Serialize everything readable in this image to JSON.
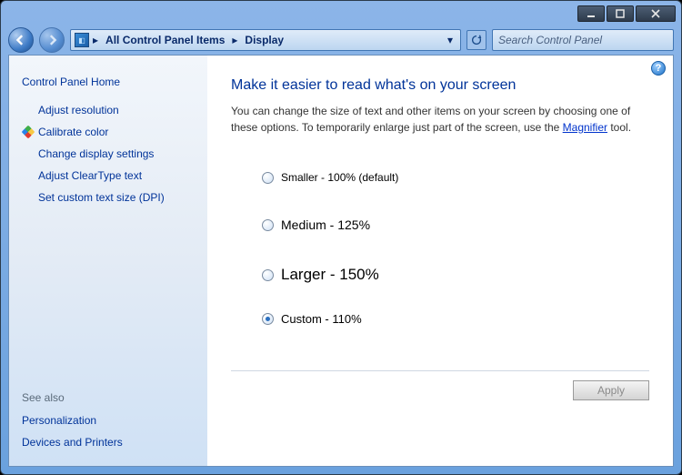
{
  "titlebar": {
    "minimize_tooltip": "Minimize",
    "maximize_tooltip": "Maximize",
    "close_tooltip": "Close"
  },
  "nav": {
    "crumb1": "All Control Panel Items",
    "crumb2": "Display",
    "search_placeholder": "Search Control Panel"
  },
  "sidebar": {
    "home": "Control Panel Home",
    "tasks": [
      {
        "label": "Adjust resolution",
        "shield": false
      },
      {
        "label": "Calibrate color",
        "shield": true
      },
      {
        "label": "Change display settings",
        "shield": false
      },
      {
        "label": "Adjust ClearType text",
        "shield": false
      },
      {
        "label": "Set custom text size (DPI)",
        "shield": false
      }
    ],
    "see_also_title": "See also",
    "see_also": [
      {
        "label": "Personalization"
      },
      {
        "label": "Devices and Printers"
      }
    ]
  },
  "main": {
    "heading": "Make it easier to read what's on your screen",
    "desc_prefix": "You can change the size of text and other items on your screen by choosing one of these options. To temporarily enlarge just part of the screen, use the ",
    "desc_link": "Magnifier",
    "desc_suffix": " tool.",
    "options": [
      {
        "label": "Smaller - 100% (default)",
        "checked": false
      },
      {
        "label": "Medium - 125%",
        "checked": false
      },
      {
        "label": "Larger - 150%",
        "checked": false
      },
      {
        "label": "Custom - 110%",
        "checked": true
      }
    ],
    "apply_label": "Apply"
  }
}
